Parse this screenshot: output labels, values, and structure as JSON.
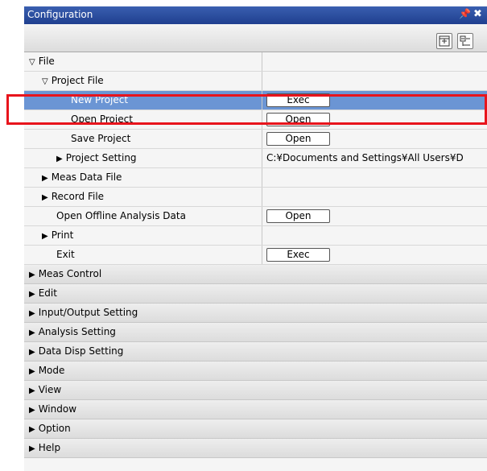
{
  "window": {
    "title": "Configuration",
    "pin_glyph": "p",
    "close_glyph": "✖"
  },
  "toolbar": {
    "btn1_icon": "expand-all-icon",
    "btn2_icon": "collapse-all-icon"
  },
  "rows": [
    {
      "kind": "item",
      "indent": 0,
      "expander": "▽",
      "label": "File",
      "value_type": "none",
      "value": ""
    },
    {
      "kind": "item",
      "indent": 1,
      "expander": "▽",
      "label": "Project File",
      "value_type": "none",
      "value": ""
    },
    {
      "kind": "item",
      "indent": 3,
      "expander": "",
      "label": "New Project",
      "value_type": "button",
      "value": "Exec",
      "selected": true
    },
    {
      "kind": "item",
      "indent": 3,
      "expander": "",
      "label": "Open Project",
      "value_type": "button",
      "value": "Open"
    },
    {
      "kind": "item",
      "indent": 3,
      "expander": "",
      "label": "Save Project",
      "value_type": "button",
      "value": "Open"
    },
    {
      "kind": "item",
      "indent": 2,
      "expander": "▶",
      "label": "Project Setting",
      "value_type": "text",
      "value": "C:¥Documents and Settings¥All Users¥D"
    },
    {
      "kind": "item",
      "indent": 1,
      "expander": "▶",
      "label": "Meas Data File",
      "value_type": "none",
      "value": ""
    },
    {
      "kind": "item",
      "indent": 1,
      "expander": "▶",
      "label": "Record File",
      "value_type": "none",
      "value": ""
    },
    {
      "kind": "item",
      "indent": 2,
      "expander": "",
      "label": "Open Offline Analysis Data",
      "value_type": "button",
      "value": "Open"
    },
    {
      "kind": "item",
      "indent": 1,
      "expander": "▶",
      "label": "Print",
      "value_type": "none",
      "value": ""
    },
    {
      "kind": "item",
      "indent": 2,
      "expander": "",
      "label": "Exit",
      "value_type": "button",
      "value": "Exec"
    },
    {
      "kind": "category",
      "indent": 0,
      "expander": "▶",
      "label": "Meas Control"
    },
    {
      "kind": "category",
      "indent": 0,
      "expander": "▶",
      "label": "Edit"
    },
    {
      "kind": "category",
      "indent": 0,
      "expander": "▶",
      "label": "Input/Output Setting"
    },
    {
      "kind": "category",
      "indent": 0,
      "expander": "▶",
      "label": "Analysis Setting"
    },
    {
      "kind": "category",
      "indent": 0,
      "expander": "▶",
      "label": "Data Disp Setting"
    },
    {
      "kind": "category",
      "indent": 0,
      "expander": "▶",
      "label": "Mode"
    },
    {
      "kind": "category",
      "indent": 0,
      "expander": "▶",
      "label": "View"
    },
    {
      "kind": "category",
      "indent": 0,
      "expander": "▶",
      "label": "Window"
    },
    {
      "kind": "category",
      "indent": 0,
      "expander": "▶",
      "label": "Option"
    },
    {
      "kind": "category",
      "indent": 0,
      "expander": "▶",
      "label": "Help"
    }
  ],
  "colors": {
    "selection": "#6b95d4",
    "title_bar": "#2a4ea0",
    "highlight_box": "#e8141c"
  }
}
